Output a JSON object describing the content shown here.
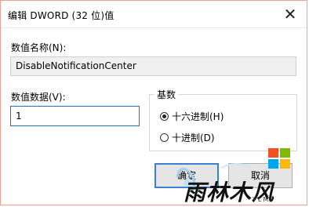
{
  "dialog": {
    "title": "编辑 DWORD (32 位)值",
    "close_glyph": "✕",
    "name_label": "数值名称(N):",
    "name_value": "DisableNotificationCenter",
    "data_label": "数值数据(V):",
    "data_value": "1",
    "base_group_label": "基数",
    "radio_hex_label": "十六进制(H)",
    "radio_dec_label": "十进制(D)",
    "selected_base": "hex",
    "ok_label": "确定",
    "cancel_label": "取消"
  },
  "watermark": {
    "logo_text": "雨林木风",
    "sub_text": "YLMF",
    "windows_colors": [
      "#f25022",
      "#7fba00",
      "#00a4ef",
      "#ffb900"
    ]
  }
}
